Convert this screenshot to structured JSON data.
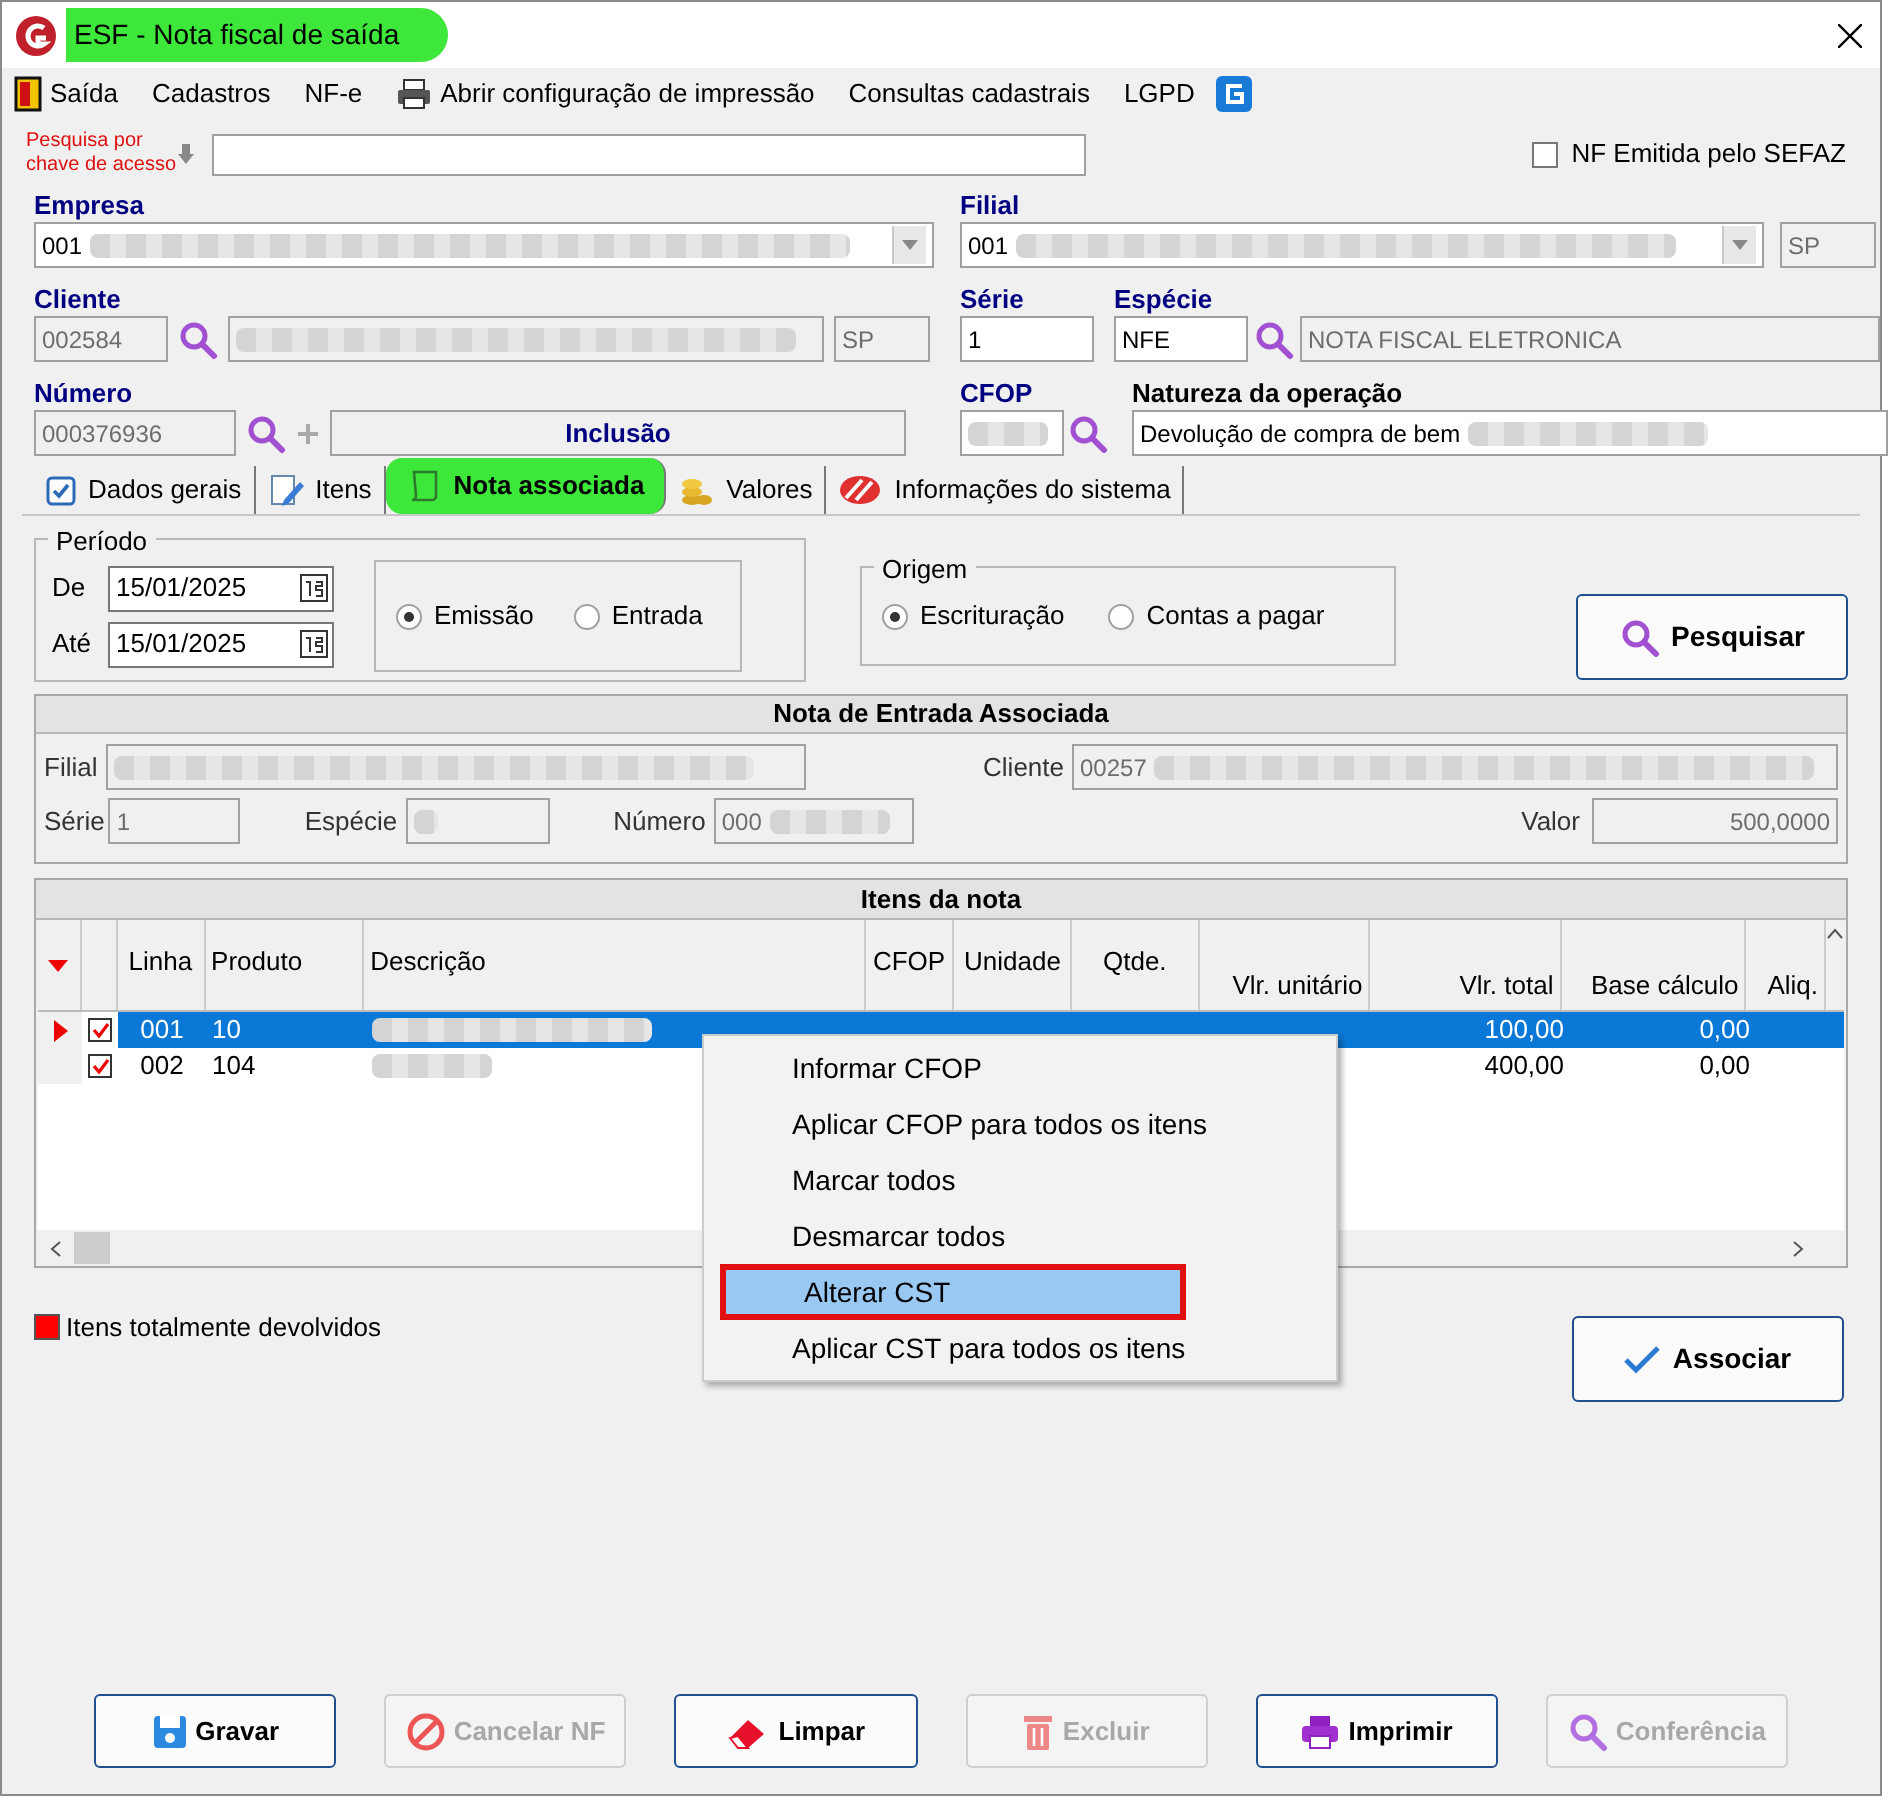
{
  "window": {
    "title": "ESF - Nota fiscal de saída",
    "title_highlighted": true
  },
  "menu": [
    {
      "label": "Saída"
    },
    {
      "label": "Cadastros"
    },
    {
      "label": "NF-e"
    },
    {
      "label": "Abrir configuração de impressão"
    },
    {
      "label": "Consultas cadastrais"
    },
    {
      "label": "LGPD"
    }
  ],
  "search": {
    "label": "Pesquisa por chave de acesso"
  },
  "sefaz": {
    "label": "NF Emitida pelo SEFAZ",
    "checked": false
  },
  "empresa": {
    "label": "Empresa",
    "value": "001"
  },
  "filial": {
    "label": "Filial",
    "value": "001",
    "uf": "SP"
  },
  "cliente": {
    "label": "Cliente",
    "value": "002584",
    "uf": "SP"
  },
  "serie": {
    "label": "Série",
    "value": "1"
  },
  "especie": {
    "label": "Espécie",
    "value": "NFE",
    "description": "NOTA FISCAL ELETRONICA"
  },
  "numero": {
    "label": "Número",
    "value": "000376936",
    "status": "Inclusão"
  },
  "cfop": {
    "label": "CFOP"
  },
  "natureza": {
    "label": "Natureza da operação",
    "value": "Devolução de compra de bem"
  },
  "tabs": [
    {
      "label": "Dados gerais",
      "selected": false,
      "highlighted": false
    },
    {
      "label": "Itens",
      "selected": false,
      "highlighted": false
    },
    {
      "label": "Nota associada",
      "selected": true,
      "highlighted": true
    },
    {
      "label": "Valores",
      "selected": false,
      "highlighted": false
    },
    {
      "label": "Informações do sistema",
      "selected": false,
      "highlighted": false
    }
  ],
  "periodo": {
    "legend": "Período",
    "de_label": "De",
    "de": "15/01/2025",
    "ate_label": "Até",
    "ate": "15/01/2025",
    "options": [
      {
        "label": "Emissão",
        "selected": true
      },
      {
        "label": "Entrada",
        "selected": false
      }
    ]
  },
  "origem": {
    "legend": "Origem",
    "options": [
      {
        "label": "Escrituração",
        "selected": true
      },
      {
        "label": "Contas a pagar",
        "selected": false
      }
    ]
  },
  "search_button": "Pesquisar",
  "nota_entrada": {
    "title": "Nota de Entrada Associada",
    "filial_label": "Filial",
    "cliente_label": "Cliente",
    "cliente": "00257",
    "serie_label": "Série",
    "serie": "1",
    "especie_label": "Espécie",
    "numero_label": "Número",
    "numero": "000",
    "valor_label": "Valor",
    "valor": "500,0000"
  },
  "itens": {
    "title": "Itens da nota",
    "columns": [
      "Linha",
      "Produto",
      "Descrição",
      "CFOP",
      "Unidade",
      "Qtde.",
      "Vlr. unitário",
      "Vlr. total",
      "Base cálculo",
      "Aliq."
    ],
    "rows": [
      {
        "selected": true,
        "checked": true,
        "linha": "001",
        "produto": "10",
        "vlr_total": "100,00",
        "base": "0,00"
      },
      {
        "selected": false,
        "checked": true,
        "linha": "002",
        "produto": "104",
        "vlr_total": "400,00",
        "base": "0,00"
      }
    ]
  },
  "legend": {
    "label": "Itens totalmente devolvidos",
    "color": "#ff0000"
  },
  "associar_button": "Associar",
  "context_menu": [
    {
      "label": "Informar CFOP",
      "selected": false,
      "outlined": false
    },
    {
      "label": "Aplicar CFOP para todos os itens",
      "selected": false,
      "outlined": false
    },
    {
      "label": "Marcar todos",
      "selected": false,
      "outlined": false
    },
    {
      "label": "Desmarcar todos",
      "selected": false,
      "outlined": false
    },
    {
      "label": "Alterar CST",
      "selected": true,
      "outlined": true
    },
    {
      "label": "Aplicar CST para todos os itens",
      "selected": false,
      "outlined": false
    }
  ],
  "buttons": [
    {
      "label": "Gravar",
      "disabled": false
    },
    {
      "label": "Cancelar NF",
      "disabled": true
    },
    {
      "label": "Limpar",
      "disabled": false
    },
    {
      "label": "Excluir",
      "disabled": true
    },
    {
      "label": "Imprimir",
      "disabled": false
    },
    {
      "label": "Conferência",
      "disabled": true
    }
  ]
}
